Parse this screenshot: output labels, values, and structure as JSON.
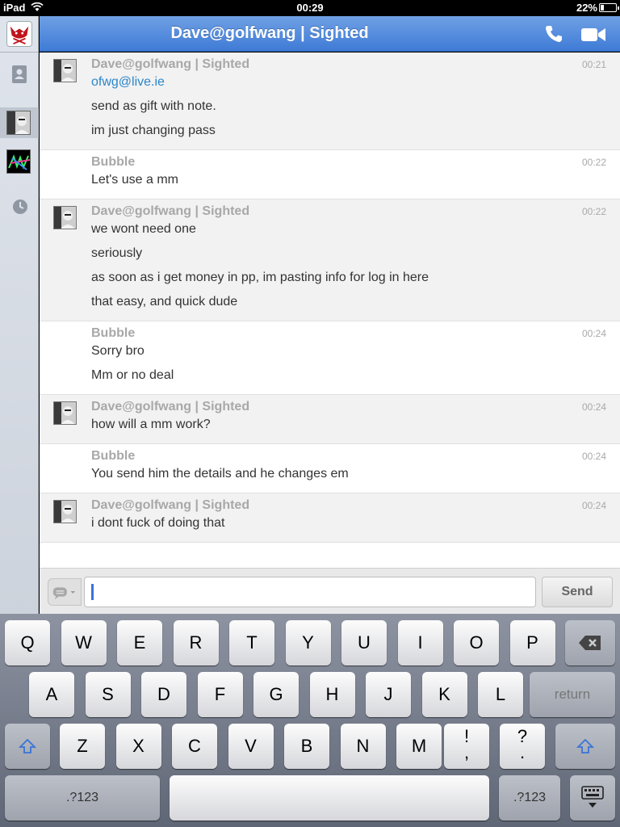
{
  "status_bar": {
    "device": "iPad",
    "time": "00:29",
    "battery": "22%",
    "battery_level": 0.22
  },
  "header": {
    "title": "Dave@golfwang | Sighted",
    "call_icon": "phone-icon",
    "video_icon": "video-camera-icon"
  },
  "sidebar": {
    "items": [
      "app-logo",
      "contacts-icon",
      "contact-avatar-dave",
      "contact-avatar-group",
      "history-clock-icon"
    ]
  },
  "messages": [
    {
      "sender": "Dave@golfwang | Sighted",
      "time": "00:21",
      "from": "them",
      "lines": [
        {
          "text": "ofwg@live.ie",
          "link": true
        },
        {
          "text": "send as gift with note."
        },
        {
          "text": "im just changing pass"
        }
      ]
    },
    {
      "sender": "Bubble",
      "time": "00:22",
      "from": "me",
      "lines": [
        {
          "text": "Let's use a mm"
        }
      ]
    },
    {
      "sender": "Dave@golfwang | Sighted",
      "time": "00:22",
      "from": "them",
      "lines": [
        {
          "text": "we wont need one"
        },
        {
          "text": "seriously"
        },
        {
          "text": "as soon as i get money in pp, im pasting info for log in here"
        },
        {
          "text": "that easy, and quick dude"
        }
      ]
    },
    {
      "sender": "Bubble",
      "time": "00:24",
      "from": "me",
      "lines": [
        {
          "text": "Sorry bro"
        },
        {
          "text": "Mm or no deal"
        }
      ]
    },
    {
      "sender": "Dave@golfwang | Sighted",
      "time": "00:24",
      "from": "them",
      "lines": [
        {
          "text": "how will a mm work?"
        }
      ]
    },
    {
      "sender": "Bubble",
      "time": "00:24",
      "from": "me",
      "lines": [
        {
          "text": "You send him the details and he changes em"
        }
      ]
    },
    {
      "sender": "Dave@golfwang | Sighted",
      "time": "00:24",
      "from": "them",
      "lines": [
        {
          "text": "i dont fuck of doing that"
        }
      ]
    }
  ],
  "input": {
    "value": "",
    "send_label": "Send",
    "mood_icon": "speech-bubble-icon"
  },
  "keyboard": {
    "row1": [
      "Q",
      "W",
      "E",
      "R",
      "T",
      "Y",
      "U",
      "I",
      "O",
      "P"
    ],
    "row2": [
      "A",
      "S",
      "D",
      "F",
      "G",
      "H",
      "J",
      "K",
      "L"
    ],
    "row3": [
      "Z",
      "X",
      "C",
      "V",
      "B",
      "N",
      "M"
    ],
    "return_label": "return",
    "numbers_label": ".?123",
    "punct1_top": "!",
    "punct1_bottom": ",",
    "punct2_top": "?",
    "punct2_bottom": "."
  }
}
